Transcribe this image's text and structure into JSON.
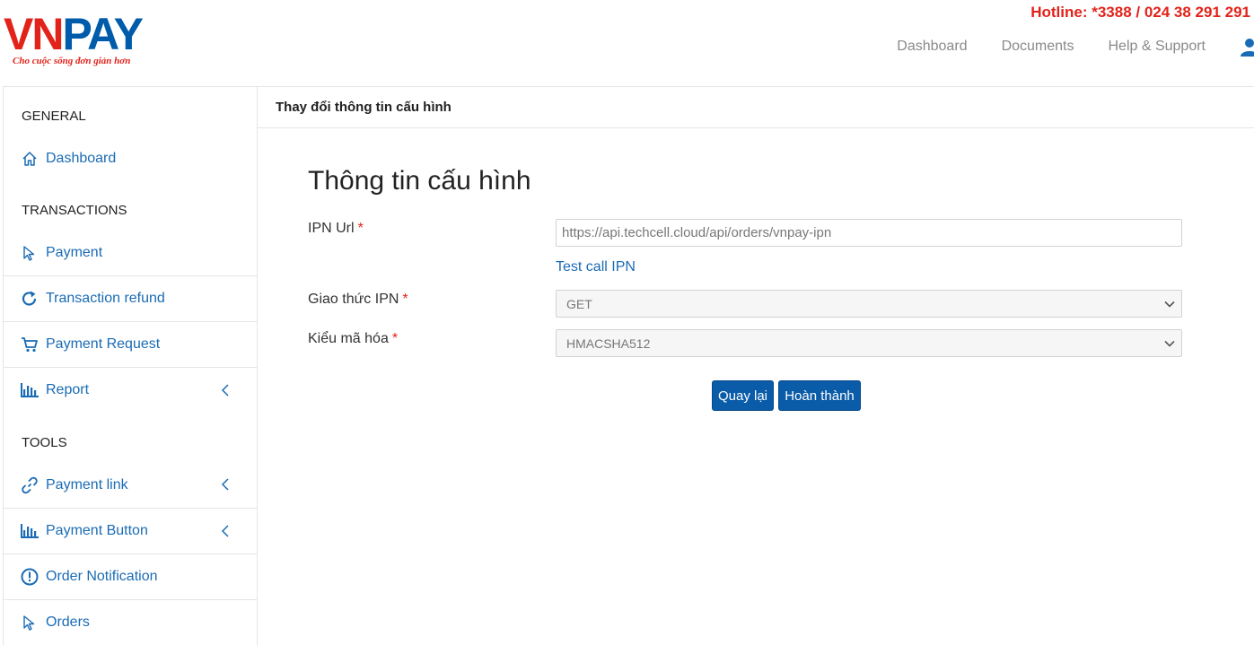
{
  "header": {
    "logo_vn": "VN",
    "logo_pay": "PAY",
    "logo_slogan": "Cho cuộc sống đơn giản hơn",
    "hotline": "Hotline: *3388 / 024 38 291 291",
    "nav": [
      "Dashboard",
      "Documents",
      "Help & Support"
    ],
    "user_icon": "user-icon"
  },
  "sidebar": {
    "sections": {
      "general": "GENERAL",
      "transactions": "TRANSACTIONS",
      "tools": "TOOLS"
    },
    "items": [
      {
        "label": "Dashboard",
        "icon": "home-icon"
      },
      {
        "label": "Payment",
        "icon": "cursor-icon"
      },
      {
        "label": "Transaction refund",
        "icon": "refresh-icon"
      },
      {
        "label": "Payment Request",
        "icon": "cart-icon"
      },
      {
        "label": "Report",
        "icon": "bar-chart-icon",
        "expandable": true
      },
      {
        "label": "Payment link",
        "icon": "link-icon",
        "expandable": true
      },
      {
        "label": "Payment Button",
        "icon": "bar-chart-icon",
        "expandable": true
      },
      {
        "label": "Order Notification",
        "icon": "alert-circle-icon"
      },
      {
        "label": "Orders",
        "icon": "cursor-icon"
      }
    ]
  },
  "content": {
    "breadcrumb_title": "Thay đổi thông tin cấu hình",
    "form_title": "Thông tin cấu hình",
    "fields": {
      "ipn_url": {
        "label": "IPN Url",
        "required": "*",
        "value": "https://api.techcell.cloud/api/orders/vnpay-ipn"
      },
      "protocol": {
        "label": "Giao thức IPN",
        "required": "*",
        "value": "GET"
      },
      "hash_type": {
        "label": "Kiểu mã hóa",
        "required": "*",
        "value": "HMACSHA512"
      }
    },
    "test_link": "Test call IPN",
    "buttons": {
      "back": "Quay lại",
      "done": "Hoàn thành"
    }
  },
  "colors": {
    "brand_red": "#e2231a",
    "brand_blue": "#005baa",
    "link_blue": "#1a6bb5",
    "button_blue": "#0a5ba8"
  }
}
